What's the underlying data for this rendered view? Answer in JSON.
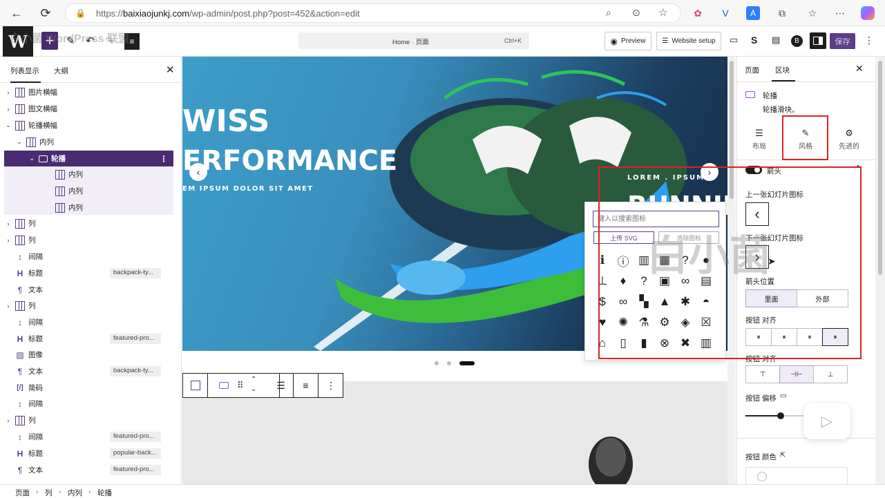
{
  "browser": {
    "url_prefix": "https://",
    "url_domain": "baixiaojunkj.com",
    "url_path": "/wp-admin/post.php?post=452&action=edit"
  },
  "toolbar": {
    "command_title": "Home · 页面",
    "command_shortcut": "Ctrl+K",
    "preview_label": "Preview",
    "website_setup_label": "Website setup",
    "save_label": "保存"
  },
  "list_view": {
    "tab_list": "列表显示",
    "tab_outline": "大纲",
    "items": [
      {
        "label": "图片横幅",
        "tag": ""
      },
      {
        "label": "图文横幅",
        "tag": ""
      },
      {
        "label": "轮播横幅",
        "tag": ""
      },
      {
        "label": "内列",
        "tag": ""
      },
      {
        "label": "轮播",
        "tag": ""
      },
      {
        "label": "内列",
        "tag": ""
      },
      {
        "label": "内列",
        "tag": ""
      },
      {
        "label": "内列",
        "tag": ""
      },
      {
        "label": "列",
        "tag": ""
      },
      {
        "label": "列",
        "tag": ""
      },
      {
        "label": "间隔",
        "tag": ""
      },
      {
        "label": "标题",
        "tag": "backpack-ty..."
      },
      {
        "label": "文本",
        "tag": ""
      },
      {
        "label": "列",
        "tag": ""
      },
      {
        "label": "间隔",
        "tag": ""
      },
      {
        "label": "标题",
        "tag": "featured-pro..."
      },
      {
        "label": "图像",
        "tag": ""
      },
      {
        "label": "文本",
        "tag": "backpack-ty..."
      },
      {
        "label": "简码",
        "tag": ""
      },
      {
        "label": "间隔",
        "tag": ""
      },
      {
        "label": "列",
        "tag": ""
      },
      {
        "label": "间隔",
        "tag": "featured-pro..."
      },
      {
        "label": "标题",
        "tag": "popular-back..."
      },
      {
        "label": "文本",
        "tag": "featured-pro..."
      }
    ]
  },
  "breadcrumb": [
    "页面",
    "列",
    "内列",
    "轮播"
  ],
  "hero": {
    "line1": "WISS",
    "line2": "ERFORMANCE",
    "line3": "EM IPSUM DOLOR SIT AMET",
    "right_line1": "LOREM . IPSUM",
    "right_line2": "RUNNIN"
  },
  "icon_picker": {
    "search_placeholder": "键入以搜索图标",
    "upload_svg_label": "上传 SVG",
    "clear_label": "清除图标"
  },
  "sidebar": {
    "tab_page": "页面",
    "tab_block": "区块",
    "block_title": "轮播",
    "block_desc": "轮播滑块。",
    "subtab_layout": "布局",
    "subtab_style": "风格",
    "subtab_advanced": "先进的",
    "arrows_label": "箭头",
    "prev_icon_label": "上一张幻灯片图标",
    "next_icon_label": "下一张幻灯片图标",
    "arrow_position_label": "箭头位置",
    "inside_label": "里面",
    "outside_label": "外部",
    "button_align_label": "按钮 对齐",
    "button_valign_label": "按钮 对齐",
    "button_offset_label": "按钮 偏移",
    "offset_value": "12",
    "button_color_label": "按钮 颜色"
  },
  "watermark": {
    "text": "白小菌",
    "logo_text": "白小菌 WordPress 联盟"
  }
}
